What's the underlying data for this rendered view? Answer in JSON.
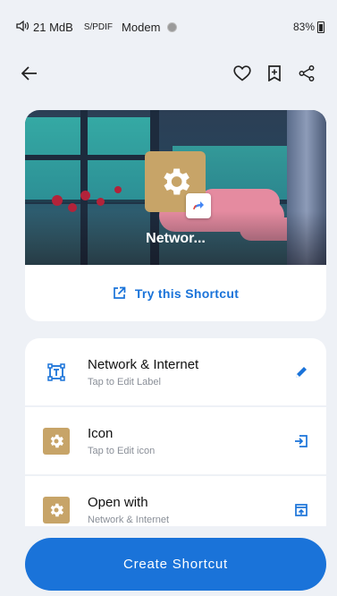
{
  "status_bar": {
    "ram": "21 MdB",
    "spdif": "S/PDIF",
    "modem": "Modem",
    "battery": "83%"
  },
  "app_bar": {
    "back_icon": "arrow-left-icon",
    "favorite_icon": "heart-outline-icon",
    "bookmark_icon": "bookmark-add-icon",
    "share_icon": "share-icon"
  },
  "preview": {
    "app_name": "Networ...",
    "tile_icon": "settings-gear-icon",
    "badge_icon": "shortcut-arrow-icon"
  },
  "try_shortcut": {
    "label": "Try this Shortcut",
    "icon": "open-external-icon"
  },
  "settings": [
    {
      "title": "Network & Internet",
      "subtitle": "Tap to Edit Label",
      "lead_icon": "text-label-icon",
      "action_icon": "pencil-icon"
    },
    {
      "title": "Icon",
      "subtitle": "Tap to Edit icon",
      "lead_icon": "settings-gear-icon",
      "action_icon": "login-arrow-icon"
    },
    {
      "title": "Open with",
      "subtitle": "Network & Internet",
      "lead_icon": "settings-gear-icon",
      "action_icon": "open-in-app-icon"
    }
  ],
  "create_button": {
    "label": "Create Shortcut"
  },
  "colors": {
    "accent": "#1a73d9",
    "tile": "#c7a468",
    "background": "#eef1f6"
  }
}
